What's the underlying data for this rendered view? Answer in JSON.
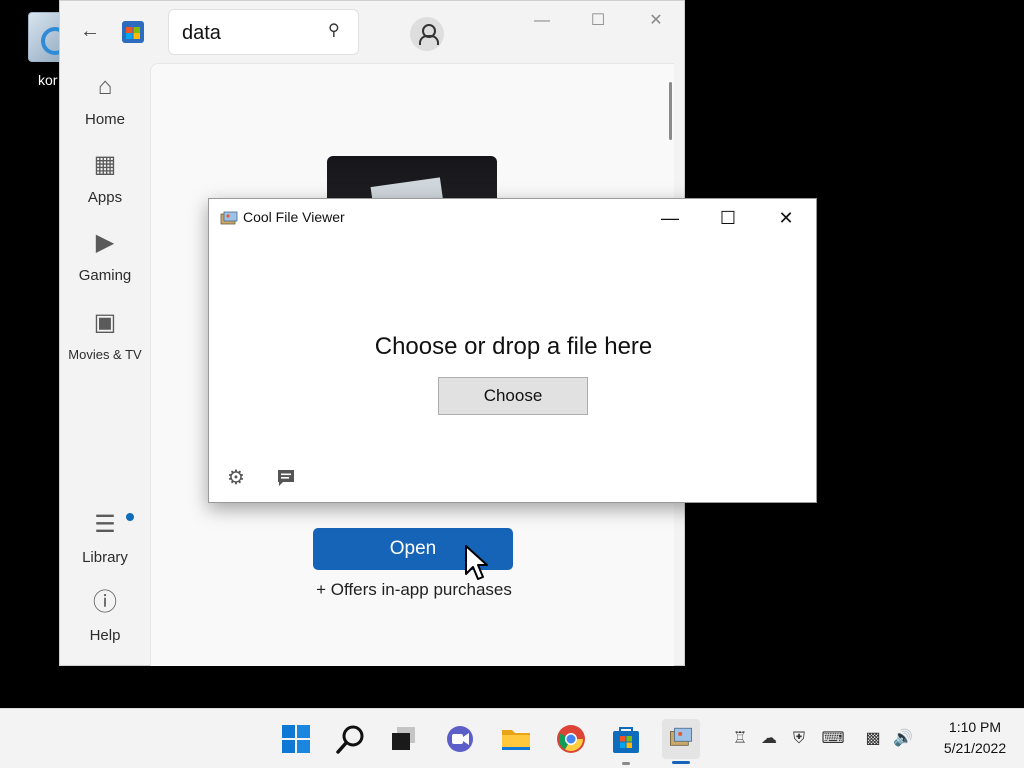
{
  "desktop": {
    "icon_label": "kor"
  },
  "store": {
    "search": {
      "value": "data"
    },
    "nav": [
      {
        "label": "Home"
      },
      {
        "label": "Apps"
      },
      {
        "label": "Gaming"
      },
      {
        "label": "Movies & TV"
      },
      {
        "label": "Library"
      },
      {
        "label": "Help"
      }
    ],
    "open_label": "Open",
    "offers_text": "+ Offers in-app purchases"
  },
  "viewer": {
    "title": "Cool File Viewer",
    "prompt": "Choose or drop a file here",
    "choose_label": "Choose"
  },
  "taskbar": {
    "time": "1:10 PM",
    "date": "5/21/2022",
    "apps": [
      "start-icon",
      "search-icon",
      "task-view-icon",
      "chat-icon",
      "file-explorer-icon",
      "chrome-icon",
      "store-icon",
      "cool-file-viewer-icon"
    ],
    "tray": [
      "teams-icon",
      "onedrive-icon",
      "security-icon",
      "keyboard-icon",
      "network-icon",
      "volume-icon"
    ]
  },
  "colors": {
    "accent": "#1664b7",
    "notification_dot": "#0f6cbd"
  }
}
